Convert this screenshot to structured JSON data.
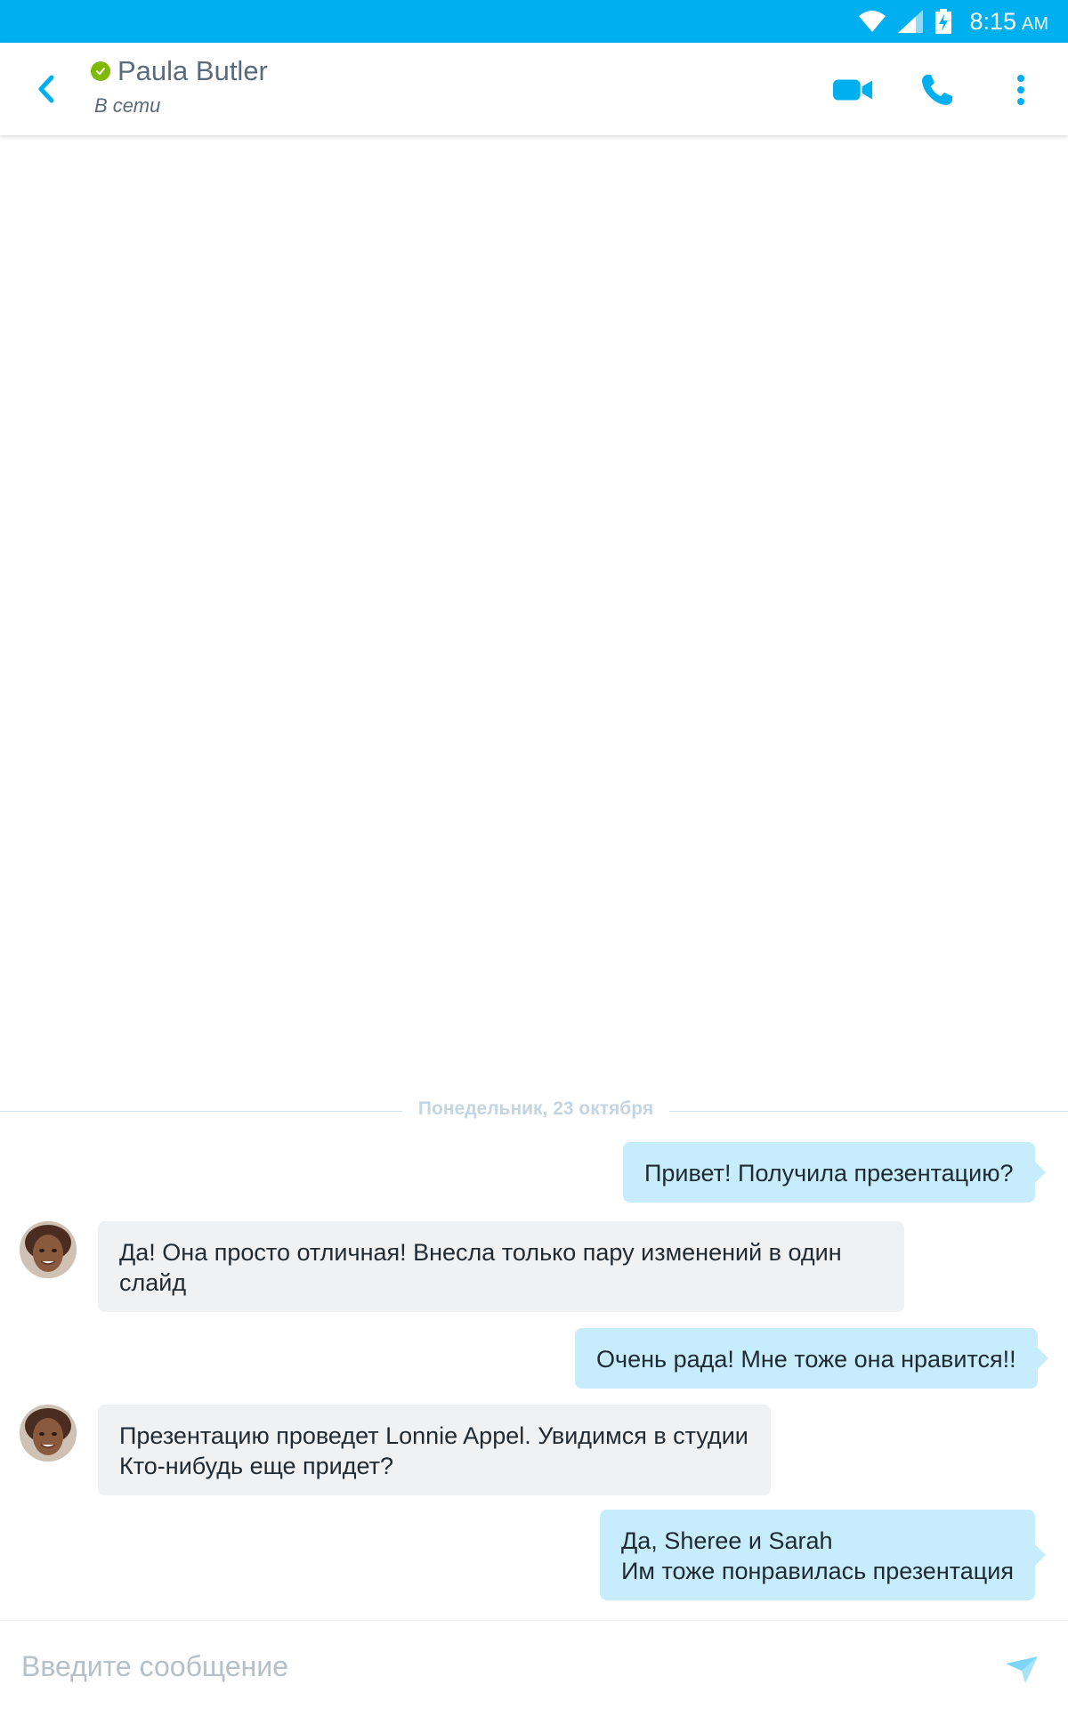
{
  "status_bar": {
    "time": "8:15",
    "ampm": "AM"
  },
  "header": {
    "contact_name": "Paula Butler",
    "contact_status": "В сети"
  },
  "icons": {
    "back": "chevron-left-icon",
    "presence": "check-circle-icon",
    "video": "video-camera-icon",
    "call": "phone-icon",
    "more": "more-vertical-icon",
    "send": "send-icon"
  },
  "colors": {
    "accent": "#00aff0",
    "presence_online": "#7fba00",
    "outgoing_bubble": "#c7edfc",
    "incoming_bubble": "#f0f1f3"
  },
  "chat": {
    "date_separator": "Понедельник, 23 октября",
    "messages": [
      {
        "direction": "out",
        "lines": [
          "Привет! Получила презентацию?"
        ]
      },
      {
        "direction": "in",
        "lines": [
          "Да! Она просто отличная! Внесла только пару изменений в один",
          "слайд"
        ]
      },
      {
        "direction": "out",
        "lines": [
          "Очень рада! Мне тоже она нравится!!"
        ]
      },
      {
        "direction": "in",
        "lines": [
          "Презентацию проведет Lonnie Appel. Увидимся в студии",
          "Кто-нибудь еще придет?"
        ]
      },
      {
        "direction": "out",
        "lines": [
          "Да, Sheree и Sarah",
          "Им тоже понравилась презентация"
        ]
      }
    ]
  },
  "composer": {
    "placeholder": "Введите сообщение"
  }
}
